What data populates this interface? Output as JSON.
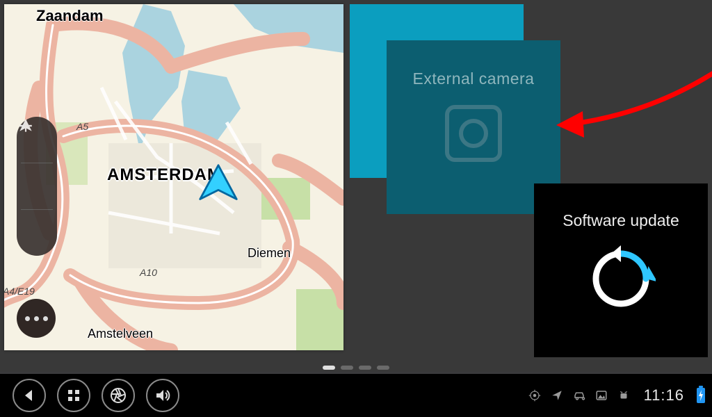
{
  "map": {
    "labels": {
      "zaandam": "Zaandam",
      "amsterdam": "AMSTERDAM",
      "diemen": "Diemen",
      "amstelveen": "Amstelveen",
      "a5": "A5",
      "a10": "A10",
      "a4e19": "A4/E19"
    }
  },
  "tiles": {
    "external_camera": {
      "title": "External camera"
    },
    "software_update": {
      "title": "Software update"
    }
  },
  "pager": {
    "active_index": 0,
    "count": 4
  },
  "statusbar": {
    "time": "11:16"
  }
}
